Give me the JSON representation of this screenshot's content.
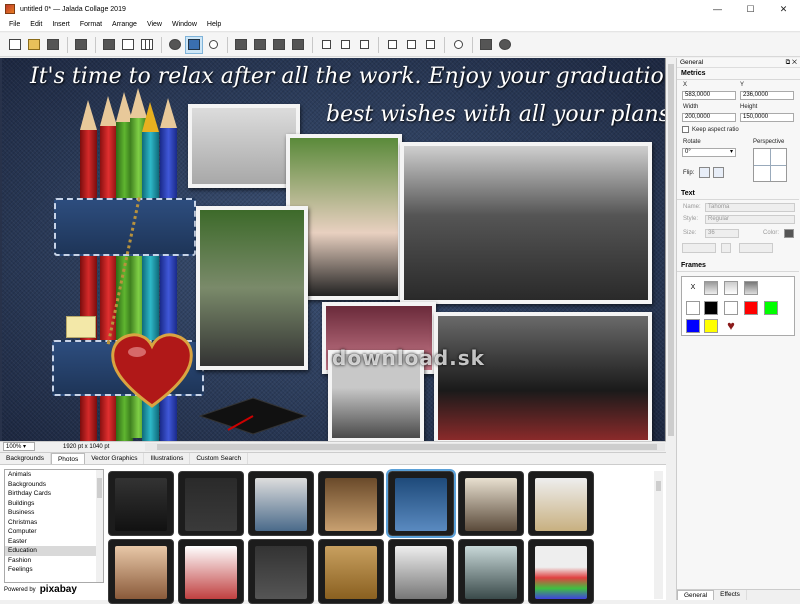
{
  "window": {
    "title": "untitled 0* — Jalada Collage 2019",
    "controls": [
      "—",
      "☐",
      "✕"
    ]
  },
  "menu": [
    "File",
    "Edit",
    "Insert",
    "Format",
    "Arrange",
    "View",
    "Window",
    "Help"
  ],
  "toolbar": {
    "icons": [
      "new-file-icon",
      "open-folder-icon",
      "save-icon",
      "print-icon",
      "insert-image-icon",
      "insert-text-icon",
      "insert-table-icon",
      "insert-clipart-icon",
      "insert-photo-icon",
      "search-image-icon",
      "bring-front-icon",
      "send-back-icon",
      "bring-forward-icon",
      "send-backward-icon",
      "align-left-icon",
      "align-center-icon",
      "align-right-icon",
      "align-top-icon",
      "align-middle-icon",
      "align-bottom-icon",
      "center-icon",
      "export-icon",
      "web-icon"
    ]
  },
  "canvas": {
    "headline_1": "It's time to relax after all the work. Enjoy your graduation and",
    "headline_2": "best wishes with all your plans!",
    "watermark": "download.sk"
  },
  "status": {
    "zoom": "100%",
    "size": "1920 pt x 1040 pt"
  },
  "bottom": {
    "tabs": [
      "Backgrounds",
      "Photos",
      "Vector Graphics",
      "Illustrations",
      "Custom Search"
    ],
    "active_tab": "Photos",
    "categories": [
      "Animals",
      "Backgrounds",
      "Birthday Cards",
      "Buildings",
      "Business",
      "Christmas",
      "Computer",
      "Easter",
      "Education",
      "Fashion",
      "Feelings"
    ],
    "selected_category": "Education",
    "powered_by": "Powered by",
    "pixabay": "pixabay"
  },
  "right_panel": {
    "header": "General",
    "metrics": {
      "title": "Metrics",
      "x_label": "X",
      "x": "583,0000",
      "y_label": "Y",
      "y": "236,0000",
      "width_label": "Width",
      "width": "200,0000",
      "height_label": "Height",
      "height": "150,0000",
      "keep_aspect": "Keep aspect ratio",
      "rotate_label": "Rotate",
      "rotate": "0°",
      "perspective_label": "Perspective",
      "flip_label": "Flip:"
    },
    "text": {
      "title": "Text",
      "name_label": "Name:",
      "name": "Tahoma",
      "style_label": "Style:",
      "style": "Regular",
      "size_label": "Size:",
      "size": "36",
      "color_label": "Color:"
    },
    "frames": {
      "title": "Frames",
      "none_label": "X"
    },
    "bottom_tabs": [
      "General",
      "Effects"
    ]
  },
  "colors": {
    "red": "#ff0000",
    "green": "#00ff00",
    "blue": "#0000ff",
    "yellow": "#ffff00",
    "black": "#000000",
    "white": "#ffffff",
    "heart": "#8b1a1a"
  }
}
